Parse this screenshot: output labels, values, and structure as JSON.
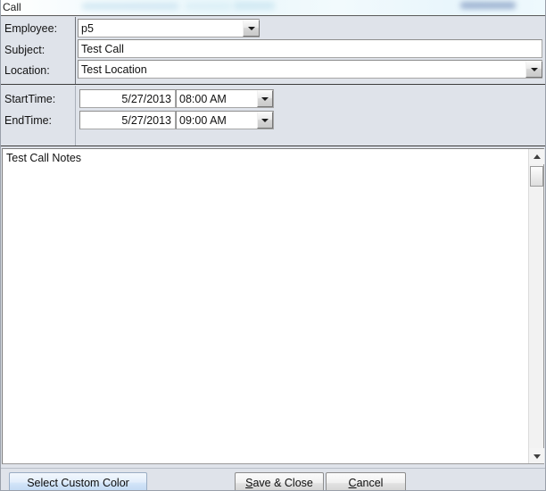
{
  "window": {
    "title": "Call"
  },
  "form": {
    "fields": [
      {
        "label": "Employee:",
        "value": "p5",
        "type": "combobox"
      },
      {
        "label": "Subject:",
        "value": "Test Call",
        "type": "text"
      },
      {
        "label": "Location:",
        "value": "Test Location",
        "type": "combobox"
      }
    ],
    "schedule": [
      {
        "label": "StartTime:",
        "date": "5/27/2013",
        "time": "08:00 AM"
      },
      {
        "label": "EndTime:",
        "date": "5/27/2013",
        "time": "09:00 AM"
      }
    ],
    "notes": {
      "value": "Test Call Notes",
      "placeholder": ""
    }
  },
  "scrollbar": {
    "up_icon": "caret-up-icon",
    "down_icon": "caret-down-icon",
    "thumb": "scroll-thumb"
  },
  "footer": {
    "select_color_label": "Select Custom Color",
    "save_close_label_prefix": "S",
    "save_close_label_rest": "ave & Close",
    "cancel_label_prefix": "C",
    "cancel_label_rest": "ancel"
  },
  "colors": {
    "panel_background": "#dfe3ea",
    "field_background": "#ffffff",
    "accent_button": "#d2e4f8",
    "text": "#111111",
    "divider": "#3d3d3d"
  }
}
